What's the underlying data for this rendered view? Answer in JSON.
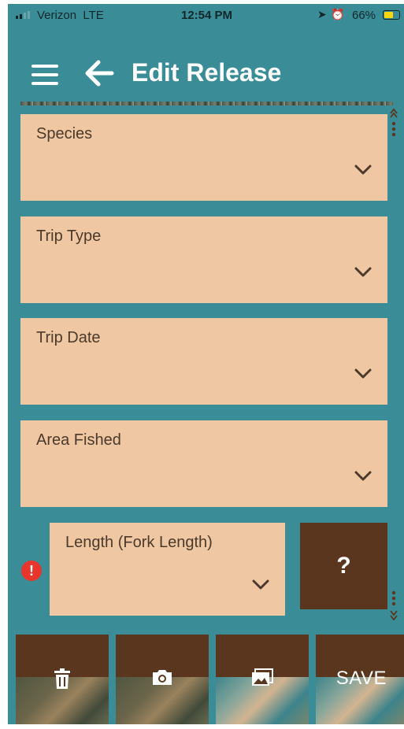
{
  "status_bar": {
    "carrier": "Verizon",
    "network": "LTE",
    "time": "12:54 PM",
    "battery_pct": "66%",
    "battery_level": 0.66,
    "battery_color": "#ffd60a"
  },
  "header": {
    "title": "Edit Release"
  },
  "fields": [
    {
      "label": "Species"
    },
    {
      "label": "Trip Type"
    },
    {
      "label": "Trip Date"
    },
    {
      "label": "Area Fished"
    },
    {
      "label": "Length (Fork Length)"
    }
  ],
  "help_button": {
    "label": "?"
  },
  "toolbar": {
    "save_label": "SAVE",
    "icons": [
      "trash-icon",
      "camera-icon",
      "gallery-icon"
    ]
  },
  "colors": {
    "background": "#3a8d97",
    "field": "#f0c7a3",
    "field_text": "#4b3a2a",
    "button_dark": "#5a361e",
    "error": "#e8362d"
  }
}
